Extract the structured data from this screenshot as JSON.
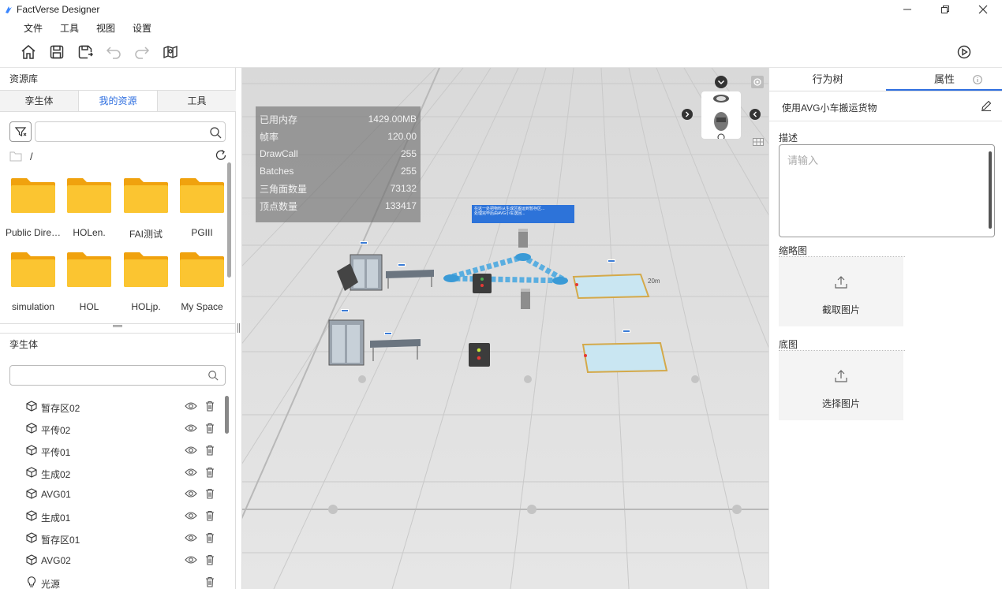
{
  "window": {
    "title": "FactVerse Designer"
  },
  "menu": {
    "items": [
      "文件",
      "工具",
      "视图",
      "设置"
    ]
  },
  "left": {
    "resource_heading": "资源库",
    "tabs": [
      "孪生体",
      "我的资源",
      "工具"
    ],
    "active_tab": "我的资源",
    "search_placeholder": "",
    "path": "/",
    "folders": [
      "Public Dire…",
      "HOLen.",
      "FAI测试",
      "PGIII",
      "simulation",
      "HOL",
      "HOLjp.",
      "My Space"
    ],
    "twin_heading": "孪生体",
    "twin_search_placeholder": "",
    "twins": [
      {
        "label": "暂存区02",
        "icon": "cube-icon"
      },
      {
        "label": "平传02",
        "icon": "cube-icon"
      },
      {
        "label": "平传01",
        "icon": "cube-icon"
      },
      {
        "label": "生成02",
        "icon": "cube-icon"
      },
      {
        "label": "AVG01",
        "icon": "cube-icon"
      },
      {
        "label": "生成01",
        "icon": "cube-icon"
      },
      {
        "label": "暂存区01",
        "icon": "cube-icon"
      },
      {
        "label": "AVG02",
        "icon": "cube-icon"
      },
      {
        "label": "光源",
        "icon": "lightbulb-icon"
      }
    ]
  },
  "viewport": {
    "stats": [
      {
        "label": "已用内存",
        "value": "1429.00MB"
      },
      {
        "label": "帧率",
        "value": "120.00"
      },
      {
        "label": "DrawCall",
        "value": "255"
      },
      {
        "label": "Batches",
        "value": "255"
      },
      {
        "label": "三角面数量",
        "value": "73132"
      },
      {
        "label": "顶点数量",
        "value": "133417"
      }
    ],
    "distance_label": "20m",
    "popup_line1": "在这一处把物料从生成区搬运到暂存区...",
    "popup_line2": "处理完毕后由AVG小车送回..."
  },
  "right": {
    "tabs": [
      "行为树",
      "属性"
    ],
    "active_tab": "属性",
    "behavior_name": "使用AVG小车搬运货物",
    "description_label": "描述",
    "description_placeholder": "请输入",
    "thumbnail_label": "缩略图",
    "thumbnail_button": "截取图片",
    "base_label": "底图",
    "base_button": "选择图片"
  },
  "colors": {
    "accent": "#2f6fe0",
    "folder": "#f7b731",
    "viewport_bg": "#e3e3e3"
  }
}
